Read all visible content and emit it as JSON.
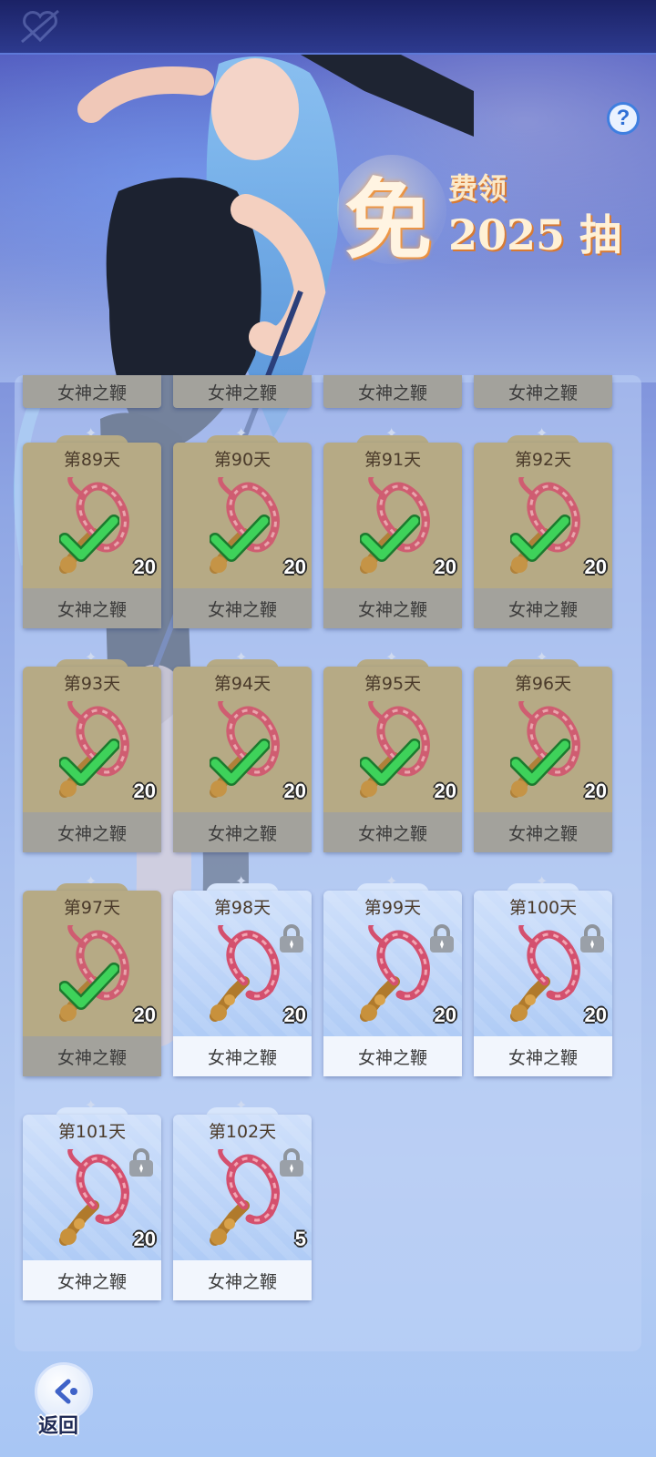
{
  "help": {
    "label": "?"
  },
  "promo": {
    "big": "免",
    "line1": "费领",
    "line2": "2025 抽"
  },
  "item_name": "女神之鞭",
  "top_strips": [
    "女神之鞭",
    "女神之鞭",
    "女神之鞭",
    "女神之鞭"
  ],
  "rewards": [
    {
      "day": "第89天",
      "qty": "20",
      "name": "女神之鞭",
      "state": "claimed"
    },
    {
      "day": "第90天",
      "qty": "20",
      "name": "女神之鞭",
      "state": "claimed"
    },
    {
      "day": "第91天",
      "qty": "20",
      "name": "女神之鞭",
      "state": "claimed"
    },
    {
      "day": "第92天",
      "qty": "20",
      "name": "女神之鞭",
      "state": "claimed"
    },
    {
      "day": "第93天",
      "qty": "20",
      "name": "女神之鞭",
      "state": "claimed"
    },
    {
      "day": "第94天",
      "qty": "20",
      "name": "女神之鞭",
      "state": "claimed"
    },
    {
      "day": "第95天",
      "qty": "20",
      "name": "女神之鞭",
      "state": "claimed"
    },
    {
      "day": "第96天",
      "qty": "20",
      "name": "女神之鞭",
      "state": "claimed"
    },
    {
      "day": "第97天",
      "qty": "20",
      "name": "女神之鞭",
      "state": "claimed"
    },
    {
      "day": "第98天",
      "qty": "20",
      "name": "女神之鞭",
      "state": "locked"
    },
    {
      "day": "第99天",
      "qty": "20",
      "name": "女神之鞭",
      "state": "locked"
    },
    {
      "day": "第100天",
      "qty": "20",
      "name": "女神之鞭",
      "state": "locked"
    },
    {
      "day": "第101天",
      "qty": "20",
      "name": "女神之鞭",
      "state": "locked"
    },
    {
      "day": "第102天",
      "qty": "5",
      "name": "女神之鞭",
      "state": "locked"
    }
  ],
  "back": {
    "label": "返回"
  },
  "colors": {
    "claimed_card": "#b6aa85",
    "locked_card": "#a7c6f4",
    "check": "#3ed25a"
  }
}
